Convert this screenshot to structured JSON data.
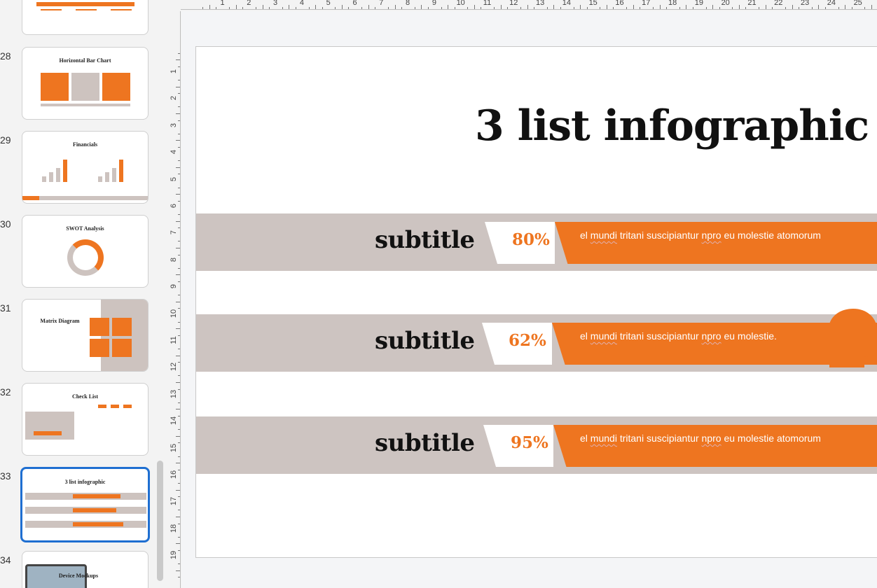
{
  "thumbnails": [
    {
      "num": "28",
      "title": "Horizontal Bar Chart"
    },
    {
      "num": "29",
      "title": "Financials"
    },
    {
      "num": "30",
      "title": "SWOT Analysis"
    },
    {
      "num": "31",
      "title": "Matrix Diagram"
    },
    {
      "num": "32",
      "title": "Check List"
    },
    {
      "num": "33",
      "title": "3 list infographic"
    },
    {
      "num": "34",
      "title": "Device Mockups"
    }
  ],
  "ruler": {
    "h": [
      "1",
      "2",
      "3",
      "4",
      "5",
      "6",
      "7",
      "8",
      "9",
      "10",
      "11",
      "12",
      "13",
      "14",
      "15",
      "16",
      "17",
      "18",
      "19",
      "20",
      "21",
      "22",
      "23",
      "24",
      "25"
    ],
    "v": [
      "1",
      "2",
      "3",
      "4",
      "5",
      "6",
      "7",
      "8",
      "9",
      "10",
      "11",
      "12",
      "13",
      "14",
      "15",
      "16",
      "17",
      "18",
      "19"
    ]
  },
  "slide": {
    "title": "3 list infographic",
    "rows": [
      {
        "subtitle": "subtitle",
        "percent": "80%",
        "text_a": "el ",
        "text_b": "mundi",
        "text_c": " tritani suscipiantur ",
        "text_d": "npro",
        "text_e": " eu molestie atomorum"
      },
      {
        "subtitle": "subtitle",
        "percent": "62%",
        "text_a": "el ",
        "text_b": "mundi",
        "text_c": " tritani suscipiantur ",
        "text_d": "npro",
        "text_e": " eu molestie."
      },
      {
        "subtitle": "subtitle",
        "percent": "95%",
        "text_a": "el ",
        "text_b": "mundi",
        "text_c": " tritani suscipiantur ",
        "text_d": "npro",
        "text_e": " eu molestie atomorum"
      }
    ]
  },
  "colors": {
    "accent": "#ee7520",
    "band": "#cdc4c1",
    "selection": "#1f6fd1"
  }
}
